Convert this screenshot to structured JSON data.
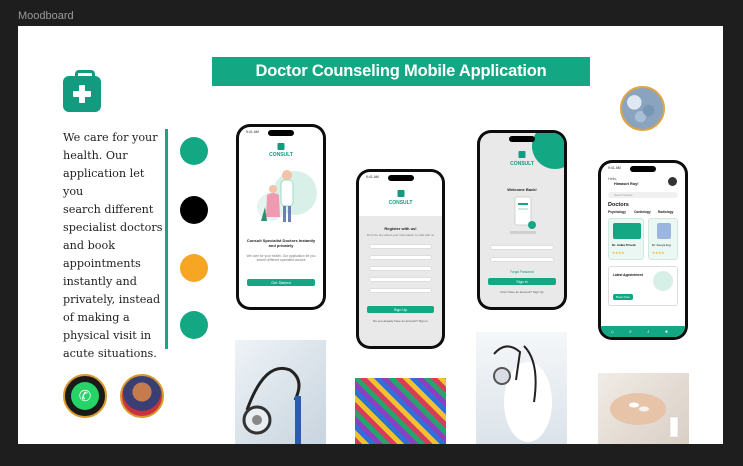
{
  "frame_label": "Moodboard",
  "title": "Doctor Counseling Mobile Application",
  "description": "We care for your health. Our application let you search different specialist doctors and book appointments instantly and privately, instead of making a physical visit in acute situations.",
  "description_lines": [
    "We care for your",
    "health. Our",
    "application let you",
    "search different",
    "specialist doctors",
    "and book",
    "appointments",
    "instantly and",
    "privately, instead",
    "of making a",
    "physical visit in",
    "acute situations."
  ],
  "colors": {
    "primary": "#13a784",
    "black": "#000000",
    "accent": "#f6a623"
  },
  "palette": [
    "#13a784",
    "#000000",
    "#f6a623",
    "#13a784"
  ],
  "icons": {
    "kit": "medical-kit-icon",
    "whatsapp": "whatsapp-icon"
  },
  "phone1": {
    "time": "9:41 AM",
    "brand": "CONSULT",
    "heading": "Consult Specialist Doctors Instantly and privately",
    "body": "We care for your health. Our application let you search different specialist doctors",
    "cta": "Get Started"
  },
  "phone2": {
    "time": "9:41 AM",
    "brand": "CONSULT",
    "heading": "Register with us!",
    "sub": "Don't be shy about your information to chat with us",
    "cta": "Sign Up",
    "footer": "Do you already have an account? Sign in"
  },
  "phone3": {
    "brand": "CONSULT",
    "heading": "Welcome Back!",
    "forgot": "Forgot Password",
    "cta": "Sign in",
    "footer": "Don't have an account? Sign Up"
  },
  "phone4": {
    "time": "9:41 AM",
    "greeting": "Hello,",
    "name": "Himasiri Roy!",
    "search": "Search doctor",
    "section": "Doctors",
    "tabs": [
      "Psychology",
      "Cardiology",
      "Radiology"
    ],
    "doctor_name": "Dr. Anika Trivedi",
    "doctor2": "Dr. Kenya ling",
    "appointment": "Latest Appointment",
    "book": "Book Now"
  }
}
